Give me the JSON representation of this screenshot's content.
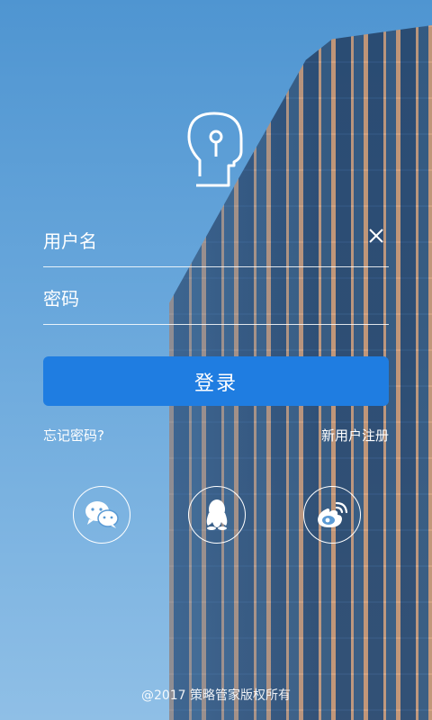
{
  "form": {
    "username_label": "用户名",
    "password_label": "密码",
    "login_label": "登录",
    "forgot_label": "忘记密码?",
    "register_label": "新用户注册"
  },
  "social": {
    "wechat_icon": "wechat-icon",
    "qq_icon": "qq-icon",
    "weibo_icon": "weibo-icon"
  },
  "footer": {
    "copyright": "@2017 策略管家版权所有"
  },
  "colors": {
    "button": "#1f7de1",
    "sky": "#4f95d1"
  }
}
